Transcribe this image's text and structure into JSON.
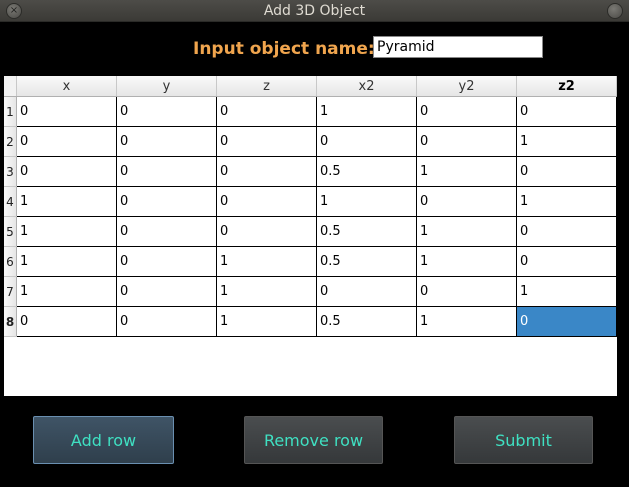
{
  "window": {
    "title": "Add 3D Object"
  },
  "form": {
    "name_label": "Input object name:",
    "name_value": "Pyramid"
  },
  "table": {
    "columns": [
      "x",
      "y",
      "z",
      "x2",
      "y2",
      "z2"
    ],
    "rows": [
      [
        "0",
        "0",
        "0",
        "1",
        "0",
        "0"
      ],
      [
        "0",
        "0",
        "0",
        "0",
        "0",
        "1"
      ],
      [
        "0",
        "0",
        "0",
        "0.5",
        "1",
        "0"
      ],
      [
        "1",
        "0",
        "0",
        "1",
        "0",
        "1"
      ],
      [
        "1",
        "0",
        "0",
        "0.5",
        "1",
        "0"
      ],
      [
        "1",
        "0",
        "1",
        "0.5",
        "1",
        "0"
      ],
      [
        "1",
        "0",
        "1",
        "0",
        "0",
        "1"
      ],
      [
        "0",
        "0",
        "1",
        "0.5",
        "1",
        "0"
      ]
    ],
    "row_numbers": [
      "1",
      "2",
      "3",
      "4",
      "5",
      "6",
      "7",
      "8"
    ]
  },
  "buttons": {
    "add_row": "Add row",
    "remove_row": "Remove row",
    "submit": "Submit"
  },
  "colors": {
    "label": "#f0a54e",
    "button_text": "#3fe0c2",
    "selection": "#3a87c7"
  }
}
